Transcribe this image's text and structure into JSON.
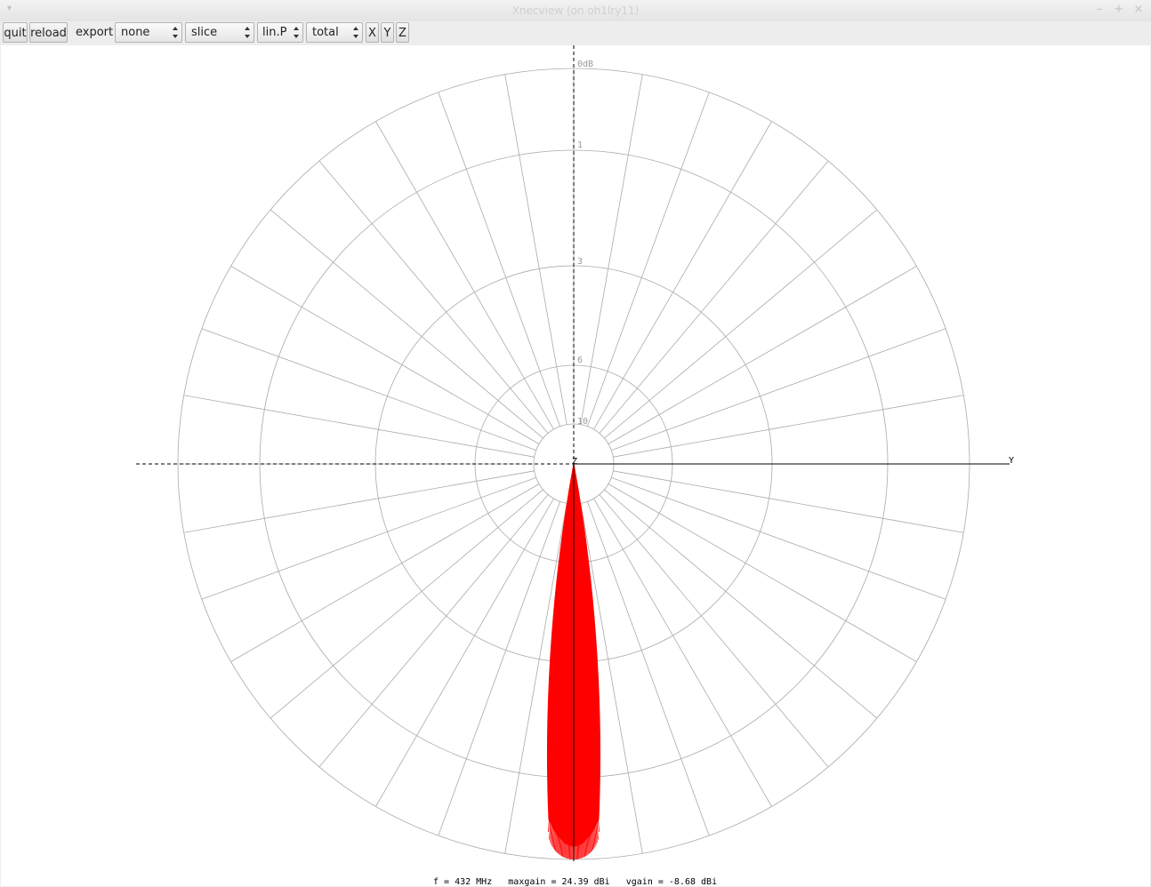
{
  "window": {
    "title": "Xnecview (on oh1lry11)",
    "menu_icon": "chevron-down-icon",
    "minimize_icon": "minimize-icon",
    "maximize_icon": "maximize-icon",
    "close_icon": "close-icon"
  },
  "toolbar": {
    "quit_label": "quit",
    "reload_label": "reload",
    "export_label": "export",
    "export_value": "none",
    "view_value": "slice",
    "scale_value": "lin.P",
    "component_value": "total",
    "x_label": "X",
    "y_label": "Y",
    "z_label": "Z"
  },
  "plot": {
    "scale_labels": [
      "0dB",
      "1",
      "3",
      "6",
      "10"
    ],
    "axis_y_label": "Y",
    "axis_z_label": "Z",
    "pattern_color": "#ff0000",
    "grid_color": "#aaaaaa",
    "status": "f = 432 MHz   maxgain = 24.39 dBi   vgain = -8.68 dBi"
  }
}
